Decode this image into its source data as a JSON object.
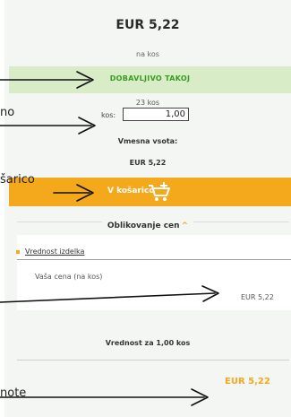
{
  "product": {
    "price": "EUR 5,22",
    "per_unit": "na kos",
    "availability": "DOBAVLJIVO TAKOJ",
    "stock": "23 kos",
    "quantity_label": "kos:",
    "quantity_value": "1,00",
    "subtotal_label": "Vmesna vsota:",
    "subtotal_value": "EUR 5,22"
  },
  "cart_button": {
    "label": "V košarico",
    "icon": "cart-plus-icon"
  },
  "pricing": {
    "title": "Oblikovanje cen",
    "caret": "^",
    "item_header": "Vrednost izdelka",
    "your_price_label": "Vaša cena (na kos)",
    "item_price": "EUR 5,22",
    "total_label": "Vrednost za 1,00 kos",
    "total_price": "EUR 5,22"
  },
  "annotations": {
    "qty_cut": "no",
    "cart_cut": "šarico",
    "unit_cut": "note"
  },
  "colors": {
    "accent_orange": "#f4a81b",
    "green_text": "#3a9a22",
    "green_bg": "#d8ecc8"
  }
}
